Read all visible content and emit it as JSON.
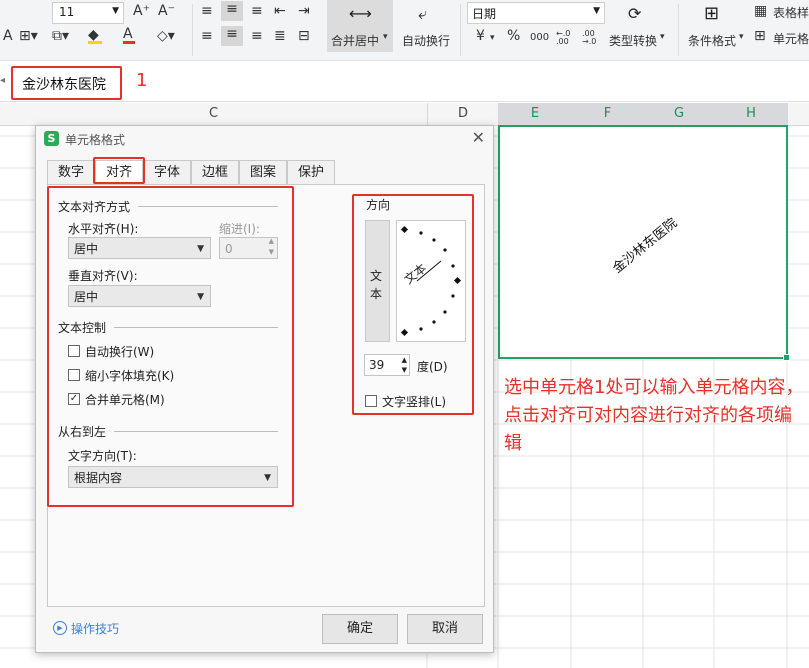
{
  "ribbon": {
    "font_size": "11",
    "font_grow": "A⁺",
    "font_shrink": "A⁻",
    "merge_center": "合并居中",
    "merge_arrow": "▾",
    "wrap_text": "自动换行",
    "number_format": "日期",
    "currency": "¥",
    "percent": "%",
    "thousands": "000",
    "dec_inc": "←.0 .00",
    "dec_dec": ".00 →.0",
    "type_convert": "类型转换",
    "cond_format": "条件格式",
    "table_style": "表格样",
    "cell_style": "单元格"
  },
  "formula_bar": {
    "cell_content": "金沙林东医院",
    "annotation_number": "1"
  },
  "columns": [
    "C",
    "D",
    "E",
    "F",
    "G",
    "H"
  ],
  "selected_cell_text": "金沙林东医院",
  "dialog": {
    "title": "单元格格式",
    "tabs": [
      "数字",
      "对齐",
      "字体",
      "边框",
      "图案",
      "保护"
    ],
    "active_tab": "对齐",
    "text_align_section": "文本对齐方式",
    "horizontal_label": "水平对齐(H):",
    "horizontal_value": "居中",
    "indent_label": "缩进(I):",
    "indent_value": "0",
    "vertical_label": "垂直对齐(V):",
    "vertical_value": "居中",
    "text_control_section": "文本控制",
    "wrap_label": "自动换行(W)",
    "shrink_label": "缩小字体填充(K)",
    "merge_label": "合并单元格(M)",
    "merge_checked": "✓",
    "rtl_section": "从右到左",
    "text_direction_label": "文字方向(T):",
    "text_direction_value": "根据内容",
    "orientation_section": "方向",
    "vertical_text_char1": "文",
    "vertical_text_char2": "本",
    "dial_text": "文本",
    "degree_value": "39",
    "degree_label": "度(D)",
    "vertical_arrange_label": "文字竖排(L)",
    "tips_label": "操作技巧",
    "ok_label": "确定",
    "cancel_label": "取消"
  },
  "annotation_note": "选中单元格1处可以输入单元格内容，点击对齐可对内容进行对齐的各项编辑",
  "colors": {
    "highlight_red": "#e8302a",
    "selection_green": "#21a366",
    "wps_green": "#2bab55"
  }
}
